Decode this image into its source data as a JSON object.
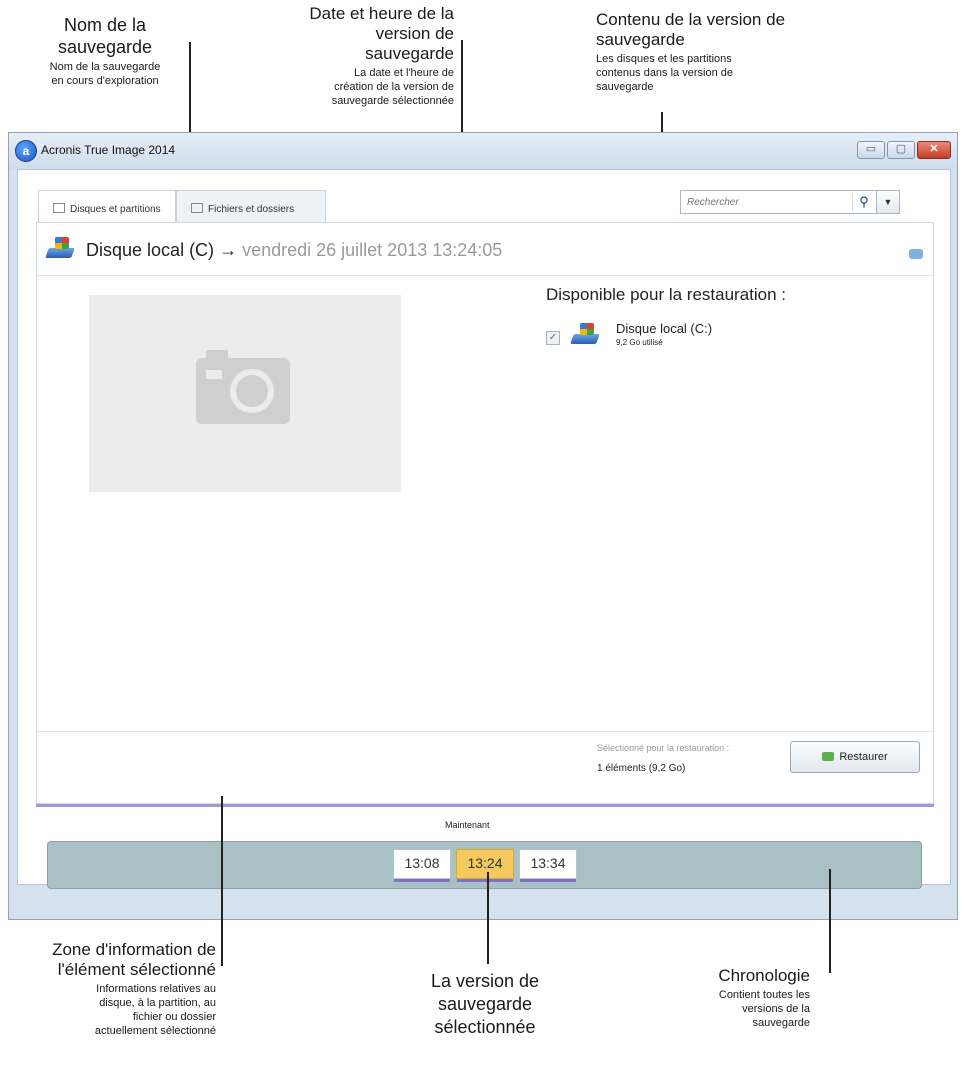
{
  "callouts": {
    "backup_name": {
      "title": "Nom de la\nsauvegarde",
      "desc": "Nom de la sauvegarde\nen cours d'exploration"
    },
    "version_date": {
      "title": "Date et heure de la\nversion de\nsauvegarde",
      "desc": "La date et l'heure de\ncréation de la version de\nsauvegarde sélectionnée"
    },
    "version_content": {
      "title": "Contenu de la version de\nsauvegarde",
      "desc": "Les disques et les partitions\ncontenus dans la version de\nsauvegarde"
    },
    "info_zone": {
      "title": "Zone d'information de\nl'élément sélectionné",
      "desc": "Informations relatives au\ndisque, à la partition, au\nfichier ou dossier\nactuellement sélectionné"
    },
    "selected_version": {
      "title": "La version de\nsauvegarde\nsélectionnée"
    },
    "timeline": {
      "title": "Chronologie",
      "desc": "Contient toutes les\nversions de la\nsauvegarde"
    }
  },
  "window": {
    "title": "Acronis True Image 2014",
    "app_icon": "acronis-logo-icon"
  },
  "tabs": [
    {
      "label": "Disques et partitions",
      "icon": "disk-icon",
      "active": true
    },
    {
      "label": "Fichiers et dossiers",
      "icon": "folder-icon",
      "active": false
    }
  ],
  "search": {
    "placeholder": "Rechercher",
    "icon": "search-icon"
  },
  "header": {
    "backup_name": "Disque local (C)",
    "arrow": "→",
    "version_date": "vendredi 26 juillet 2013 13:24:05"
  },
  "available": {
    "title": "Disponible pour la restauration :",
    "items": [
      {
        "name": "Disque local (C:)",
        "size": "9,2 Go utilisé",
        "checked": true
      }
    ]
  },
  "footer": {
    "selected_label": "Sélectionné pour la restauration :",
    "selected_value": "1 éléments (9,2 Go)",
    "restore_label": "Restaurer"
  },
  "timeline": {
    "now_label": "Maintenant",
    "versions": [
      "13:08",
      "13:24",
      "13:34"
    ],
    "selected": "13:24"
  }
}
